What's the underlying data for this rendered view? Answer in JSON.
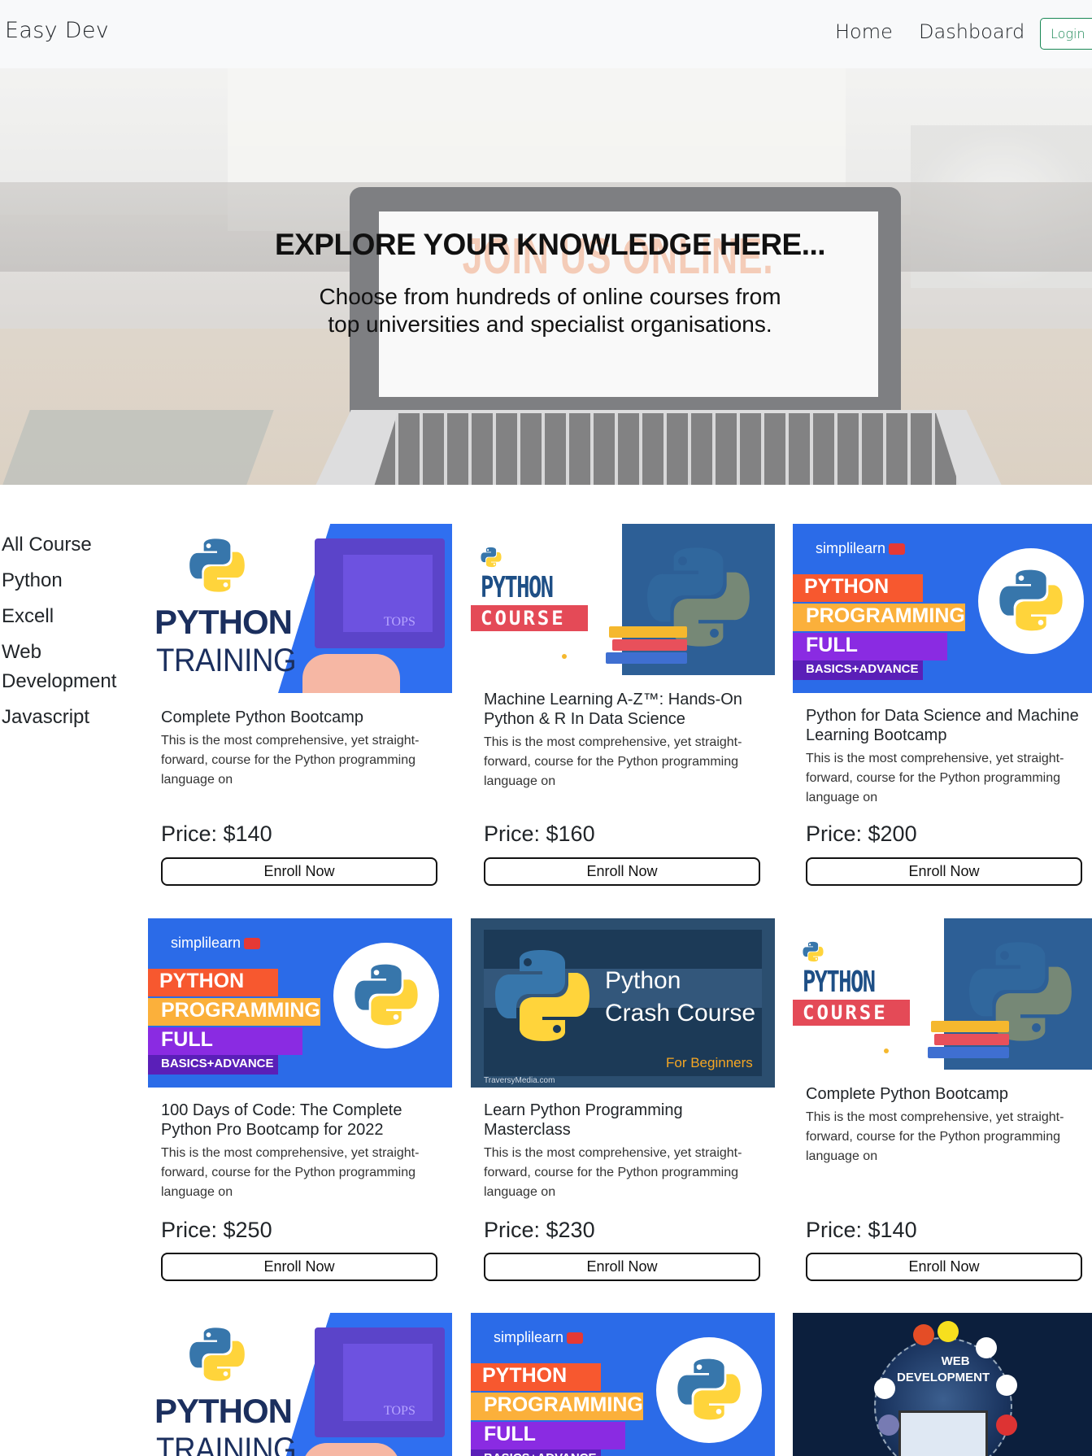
{
  "navbar": {
    "brand": "Easy Dev",
    "links": [
      "Home",
      "Dashboard"
    ],
    "login_label": "Login"
  },
  "hero": {
    "background_sign": "JOIN US ONLINE.",
    "title": "EXPLORE YOUR KNOWLEDGE HERE...",
    "subtitle_line1": "Choose from hundreds of online courses from",
    "subtitle_line2": "top universities and specialist organisations."
  },
  "sidebar": {
    "items": [
      "All Course",
      "Python",
      "Excell",
      "Web Development",
      "Javascript"
    ]
  },
  "thumb_text": {
    "python": "PYTHON",
    "training": "TRAINING",
    "tops": "TOPS",
    "course": "COURSE",
    "simplilearn": "simplilearn",
    "programming": "PROGRAMMING",
    "full_course": "FULL COURSE",
    "basics": "BASICS+ADVANCE",
    "crash_python": "Python",
    "crash_course": "Crash Course",
    "for_beginners": "For Beginners",
    "traversy": "TraversyMedia.com",
    "web": "WEB",
    "development": "DEVELOPMENT"
  },
  "courses": [
    {
      "title": "Complete Python Bootcamp",
      "description": "This is the most comprehensive, yet straight-forward, course for the Python programming language on",
      "price": "Price: $140",
      "button": "Enroll Now",
      "thumbnail": "python-training"
    },
    {
      "title": "Machine Learning A-Z™: Hands-On Python & R In Data Science",
      "description": "This is the most comprehensive, yet straight-forward, course for the Python programming language on",
      "price": "Price: $160",
      "button": "Enroll Now",
      "thumbnail": "python-course"
    },
    {
      "title": "Python for Data Science and Machine Learning Bootcamp",
      "description": "This is the most comprehensive, yet straight-forward, course for the Python programming language on",
      "price": "Price: $200",
      "button": "Enroll Now",
      "thumbnail": "simplilearn-python"
    },
    {
      "title": "100 Days of Code: The Complete Python Pro Bootcamp for 2022",
      "description": "This is the most comprehensive, yet straight-forward, course for the Python programming language on",
      "price": "Price: $250",
      "button": "Enroll Now",
      "thumbnail": "simplilearn-python"
    },
    {
      "title": "Learn Python Programming Masterclass",
      "description": "This is the most comprehensive, yet straight-forward, course for the Python programming language on",
      "price": "Price: $230",
      "button": "Enroll Now",
      "thumbnail": "python-crash-course"
    },
    {
      "title": "Complete Python Bootcamp",
      "description": "This is the most comprehensive, yet straight-forward, course for the Python programming language on",
      "price": "Price: $140",
      "button": "Enroll Now",
      "thumbnail": "python-course"
    }
  ],
  "colors": {
    "navbar_bg": "#f8f9fa",
    "login_accent": "#198754",
    "python_blue": "#3776ab",
    "python_yellow": "#ffd43b"
  }
}
